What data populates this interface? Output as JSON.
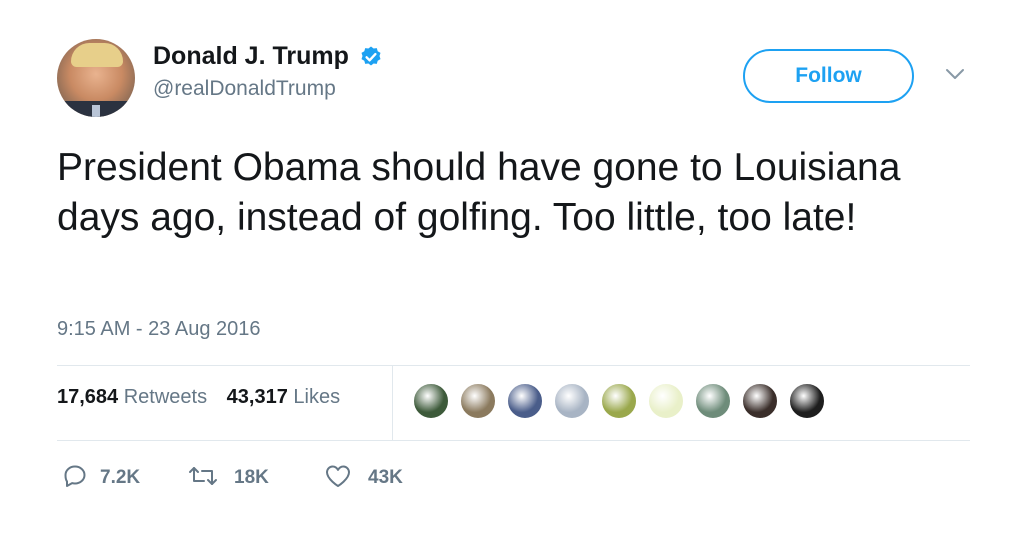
{
  "user": {
    "display_name": "Donald J. Trump",
    "handle": "@realDonaldTrump",
    "verified": true
  },
  "follow_button": {
    "label": "Follow"
  },
  "tweet": {
    "text": "President Obama should have gone to Louisiana days ago, instead of golfing. Too little, too late!",
    "timestamp": "9:15 AM - 23 Aug 2016"
  },
  "stats": {
    "retweets_count": "17,684",
    "retweets_label": "Retweets",
    "likes_count": "43,317",
    "likes_label": "Likes"
  },
  "liker_avatars": [
    {
      "name": "liker-avatar-1",
      "color": "#3d5a3a"
    },
    {
      "name": "liker-avatar-2",
      "color": "#8b7a5e"
    },
    {
      "name": "liker-avatar-3",
      "color": "#4a5d8a"
    },
    {
      "name": "liker-avatar-4",
      "color": "#a8b4c4"
    },
    {
      "name": "liker-avatar-5",
      "color": "#9aa84c"
    },
    {
      "name": "liker-avatar-6",
      "color": "#e9f0c9"
    },
    {
      "name": "liker-avatar-7",
      "color": "#6e8c7a"
    },
    {
      "name": "liker-avatar-8",
      "color": "#3a2e2a"
    },
    {
      "name": "liker-avatar-9",
      "color": "#1e1e1e"
    }
  ],
  "actions": {
    "reply_count": "7.2K",
    "retweet_count": "18K",
    "like_count": "43K"
  },
  "colors": {
    "accent": "#1da1f2",
    "secondary_text": "#657786",
    "primary_text": "#14171a",
    "divider": "#e1e8ed"
  },
  "icons": [
    "verified-badge-icon",
    "chevron-down-icon",
    "reply-icon",
    "retweet-icon",
    "heart-icon"
  ]
}
